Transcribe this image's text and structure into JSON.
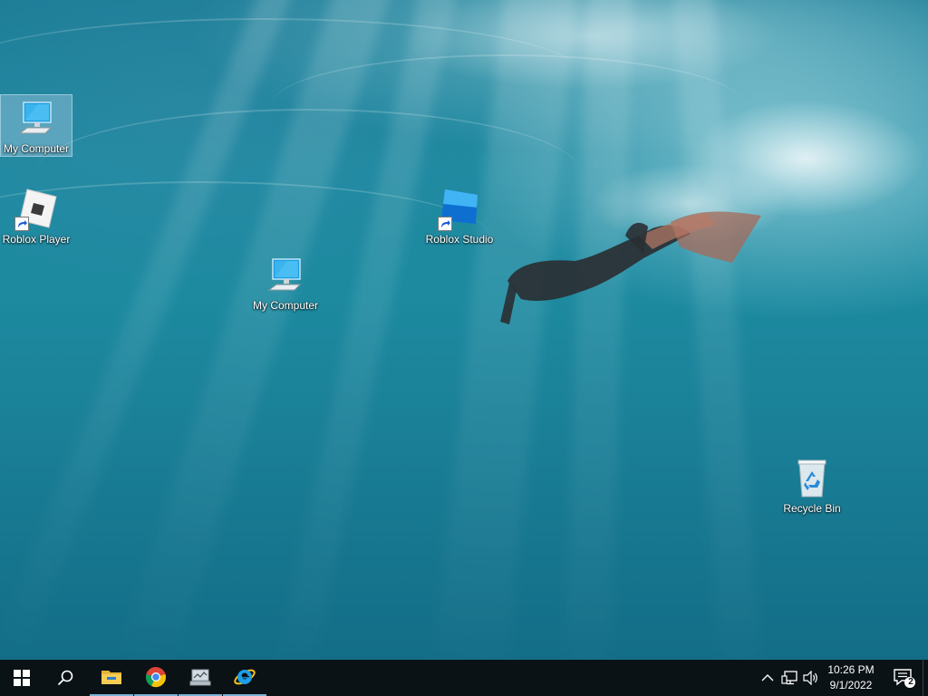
{
  "desktop": {
    "icons": [
      {
        "label": "My Computer",
        "icon": "computer-icon",
        "selected": true
      },
      {
        "label": "Roblox Player",
        "icon": "roblox-player-icon",
        "shortcut": true
      },
      {
        "label": "Roblox Studio",
        "icon": "roblox-studio-icon",
        "shortcut": true
      },
      {
        "label": "My Computer",
        "icon": "computer-icon"
      },
      {
        "label": "Recycle Bin",
        "icon": "recycle-bin-icon"
      }
    ]
  },
  "taskbar": {
    "start_icon": "windows-start-icon",
    "search_icon": "search-icon",
    "pinned": [
      {
        "icon": "file-explorer-icon",
        "running": true
      },
      {
        "icon": "chrome-icon",
        "running": true
      },
      {
        "icon": "network-monitor-icon",
        "running": true
      },
      {
        "icon": "internet-explorer-icon",
        "running": true
      }
    ],
    "tray": {
      "icons": [
        "chevron-up-icon",
        "network-icon",
        "volume-icon"
      ],
      "time": "10:26 PM",
      "date": "9/1/2022",
      "notification_count": "2"
    }
  },
  "colors": {
    "taskbar_bg": "#0b1216",
    "running_indicator": "#7ab3d6",
    "water": "#1d8aa0"
  }
}
